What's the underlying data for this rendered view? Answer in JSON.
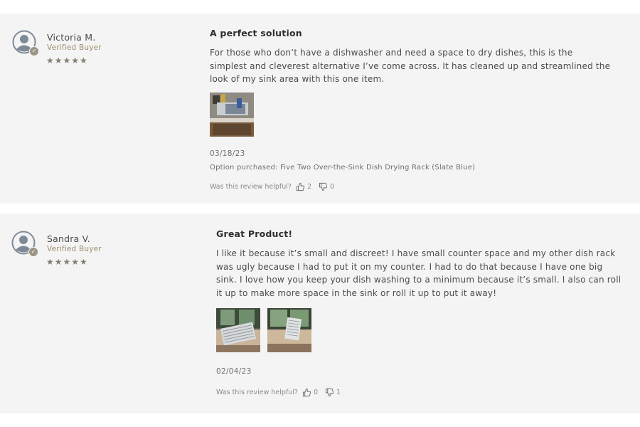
{
  "reviews": [
    {
      "reviewer": "Victoria M.",
      "verified_label": "Verified Buyer",
      "stars": "★★★★★",
      "rating": 5,
      "title": "A perfect solution",
      "body_lines": [
        "For those who don’t have a dishwasher and need a space to dry dishes, this is the",
        "simplest and cleverest alternative I’ve come across. It has cleaned up and streamlined the",
        "look of my sink area with this one item."
      ],
      "date": "03/18/23",
      "option": "Option purchased: Five Two Over-the-Sink Dish Drying Rack (Slate Blue)",
      "helpful_label": "Was this review helpful?",
      "up_count": "2",
      "down_count": "0"
    },
    {
      "reviewer": "Sandra V.",
      "verified_label": "Verified Buyer",
      "stars": "★★★★★",
      "rating": 5,
      "title": "Great Product!",
      "body_lines": [
        "I like it because it’s small and discreet! I have small counter space and my other dish rack",
        "was ugly because I had to put it on my counter. I had to do that because I have one big",
        "sink. I love how you keep your dish washing to a minimum because it’s small. I also can roll",
        "it up to make more space in the sink or roll it up to put it away!"
      ],
      "date": "02/04/23",
      "helpful_label": "Was this review helpful?",
      "up_count": "0",
      "down_count": "1"
    }
  ],
  "icons": {
    "avatar": "user-avatar-icon",
    "verified": "check-badge-icon",
    "thumbs_up": "thumbs-up-icon",
    "thumbs_down": "thumbs-down-icon"
  },
  "colors": {
    "card_background": "#f4f4f4",
    "avatar": "#7f8a99",
    "verified_text": "#9d8f6f",
    "stars": "#857f73"
  }
}
